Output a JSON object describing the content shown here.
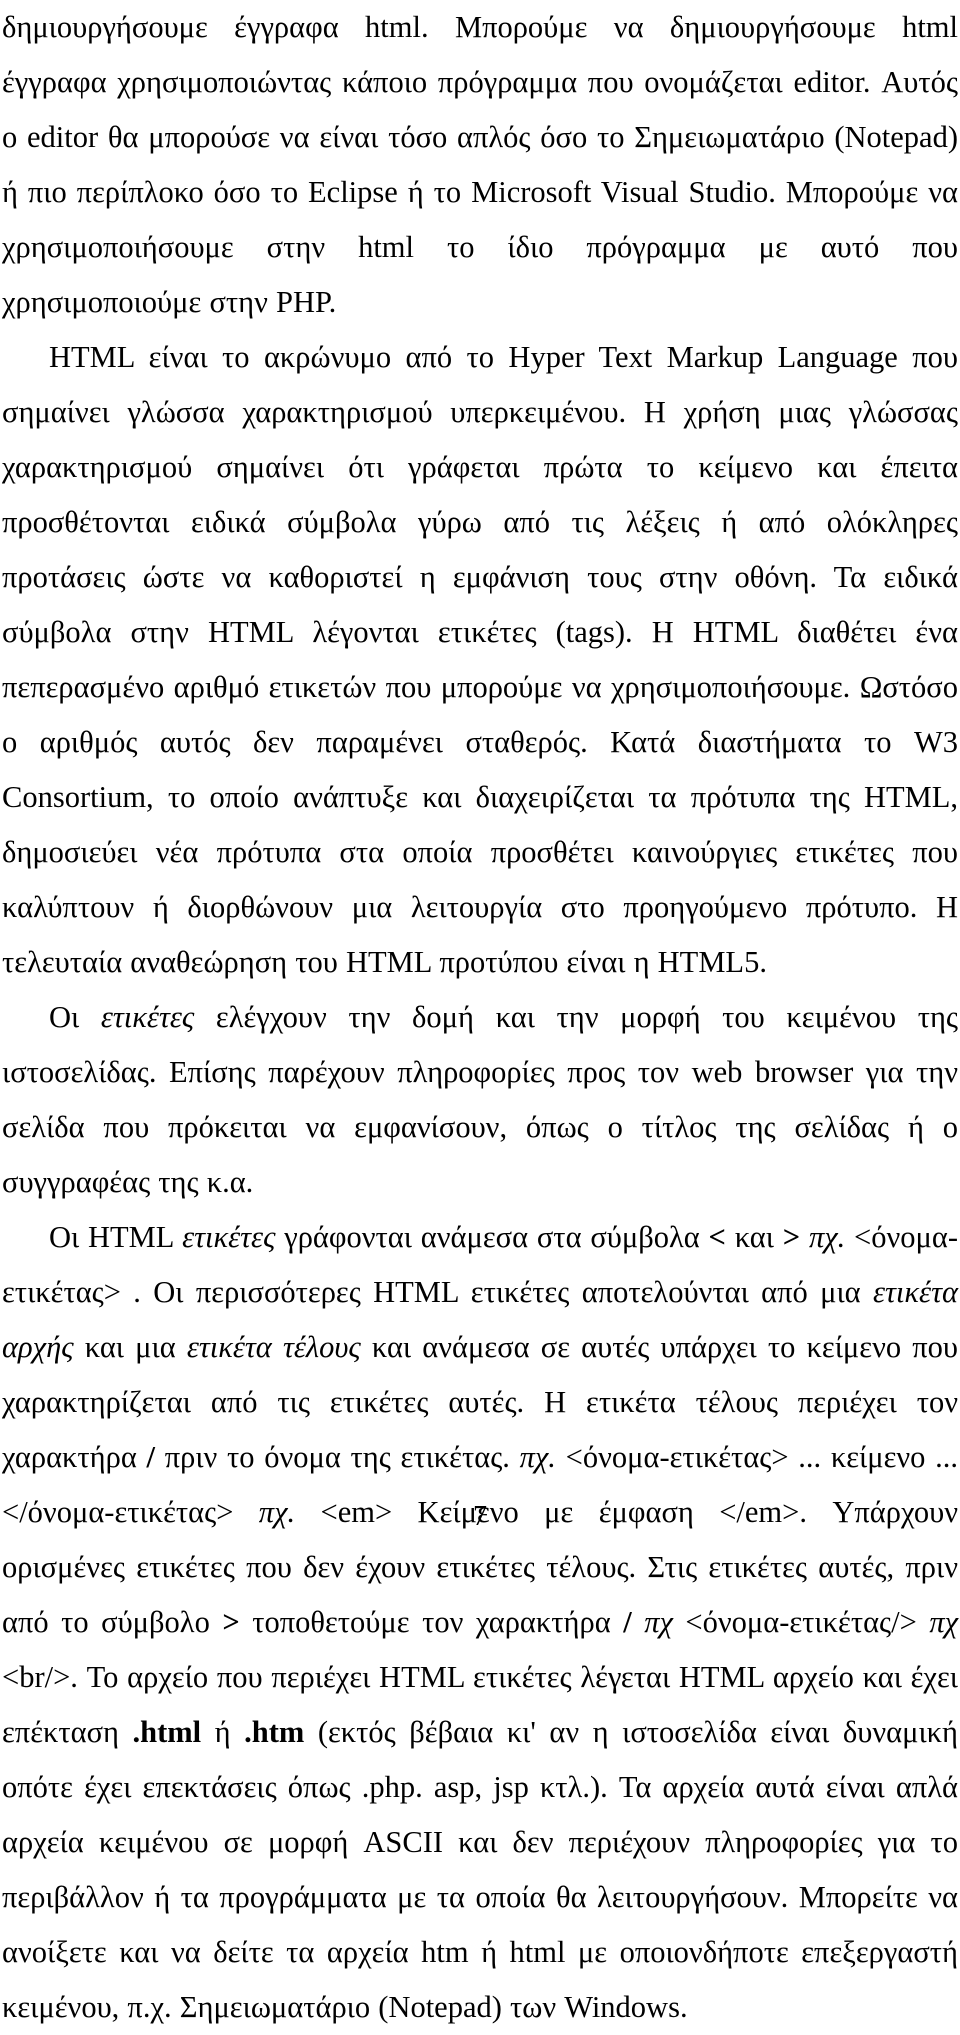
{
  "document": {
    "page_number": "7",
    "language": "el",
    "paragraphs": [
      {
        "id": "p1",
        "indent": false,
        "runs": [
          {
            "text": "δημιουργήσουμε έγγραφα html. Μπορούμε να δημιουργήσουμε html έγγραφα χρησιμοποιώντας κάποιο πρόγραμμα που ονομάζεται editor. Αυτός ο editor θα μπορούσε να είναι τόσο απλός όσο το Σημειωματάριο (Notepad) ή πιο περίπλοκο όσο το Eclipse ή το Microsoft Visual Studio. Μπορούμε να χρησιμοποιήσουμε στην html το ίδιο πρόγραμμα με αυτό που χρησιμοποιούμε στην PHP.",
            "style": "normal"
          }
        ]
      },
      {
        "id": "p2",
        "indent": true,
        "runs": [
          {
            "text": "HTML είναι το ακρώνυμο από το Hyper Text Markup Language που σημαίνει γλώσσα χαρακτηρισμού υπερκειμένου. Η χρήση μιας γλώσσας χαρακτηρισμού σημαίνει ότι γράφεται πρώτα το κείμενο και έπειτα προσθέτονται ειδικά σύμβολα γύρω από τις λέξεις ή από ολόκληρες προτάσεις ώστε να καθοριστεί η εμφάνιση τους στην οθόνη. Τα ειδικά σύμβολα στην HTML λέγονται ετικέτες (tags). Η HTML διαθέτει ένα πεπερασμένο αριθμό ετικετών που μπορούμε να χρησιμοποιήσουμε. Ωστόσο ο αριθμός αυτός δεν παραμένει σταθερός. Κατά διαστήματα το W3 Consortium, το οποίο ανάπτυξε και διαχειρίζεται τα πρότυπα της HTML, δημοσιεύει νέα πρότυπα στα οποία προσθέτει καινούργιες ετικέτες που καλύπτουν ή διορθώνουν μια λειτουργία στο προηγούμενο πρότυπο. Η τελευταία αναθεώρηση του HTML προτύπου είναι η HTML5.",
            "style": "normal"
          }
        ]
      },
      {
        "id": "p3",
        "indent": true,
        "runs": [
          {
            "text": "Οι ",
            "style": "normal"
          },
          {
            "text": "ετικέτες",
            "style": "italic"
          },
          {
            "text": " ελέγχουν την δομή και την μορφή του κειμένου της ιστοσελίδας. Επίσης παρέχουν πληροφορίες προς τον web browser για την σελίδα που πρόκειται να εμφανίσουν, όπως ο τίτλος της σελίδας ή ο συγγραφέας της κ.α.",
            "style": "normal"
          }
        ]
      },
      {
        "id": "p4",
        "indent": true,
        "runs": [
          {
            "text": "Οι HTML ",
            "style": "normal"
          },
          {
            "text": "ετικέτες",
            "style": "italic"
          },
          {
            "text": " γράφονται ανάμεσα στα σύμβολα ",
            "style": "normal"
          },
          {
            "text": "<",
            "style": "bold"
          },
          {
            "text": " και ",
            "style": "normal"
          },
          {
            "text": ">",
            "style": "bold"
          },
          {
            "text": " ",
            "style": "normal"
          },
          {
            "text": "πχ.",
            "style": "italic"
          },
          {
            "text": " <όνομα-ετικέτας> . Οι περισσότερες HTML ετικέτες αποτελούνται από μια ",
            "style": "normal"
          },
          {
            "text": "ετικέτα αρχής",
            "style": "italic"
          },
          {
            "text": " και μια ",
            "style": "normal"
          },
          {
            "text": "ετικέτα τέλους",
            "style": "italic"
          },
          {
            "text": " και ανάμεσα σε αυτές υπάρχει το κείμενο που χαρακτηρίζεται από τις ετικέτες αυτές. Η ετικέτα τέλους περιέχει τον χαρακτήρα ",
            "style": "normal"
          },
          {
            "text": "/",
            "style": "bold"
          },
          {
            "text": " πριν το όνομα της ετικέτας. ",
            "style": "normal"
          },
          {
            "text": "πχ.",
            "style": "italic"
          },
          {
            "text": " <όνομα-ετικέτας> ... κείμενο ... </όνομα-ετικέτας> ",
            "style": "normal"
          },
          {
            "text": "πχ.",
            "style": "italic"
          },
          {
            "text": " <em> Κείμενο με έμφαση </em>. Υπάρχουν ορισμένες ετικέτες που δεν έχουν ετικέτες τέλους. Στις ετικέτες αυτές, πριν από το σύμβολο ",
            "style": "normal"
          },
          {
            "text": ">",
            "style": "bold"
          },
          {
            "text": " τοποθετούμε τον χαρακτήρα ",
            "style": "normal"
          },
          {
            "text": "/",
            "style": "bold"
          },
          {
            "text": " ",
            "style": "normal"
          },
          {
            "text": "πχ",
            "style": "italic"
          },
          {
            "text": " <όνομα-ετικέτας/> ",
            "style": "normal"
          },
          {
            "text": "πχ",
            "style": "italic"
          },
          {
            "text": " <br/>. Το αρχείο που περιέχει HTML ετικέτες λέγεται HTML αρχείο και έχει επέκταση ",
            "style": "normal"
          },
          {
            "text": ".html",
            "style": "bold"
          },
          {
            "text": " ή ",
            "style": "normal"
          },
          {
            "text": ".htm",
            "style": "bold"
          },
          {
            "text": " (εκτός βέβαια κι' αν η ιστοσελίδα είναι δυναμική οπότε έχει επεκτάσεις όπως .php. asp, jsp κτλ.). Τα αρχεία αυτά είναι απλά αρχεία κειμένου σε μορφή ASCII και δεν περιέχουν πληροφορίες για το περιβάλλον ή τα προγράμματα με τα οποία θα λειτουργήσουν. Μπορείτε να ανοίξετε και να δείτε τα αρχεία htm ή html με οποιονδήποτε επεξεργαστή κειμένου, π.χ. Σημειωματάριο (Notepad) των Windows.",
            "style": "normal"
          }
        ]
      }
    ]
  }
}
